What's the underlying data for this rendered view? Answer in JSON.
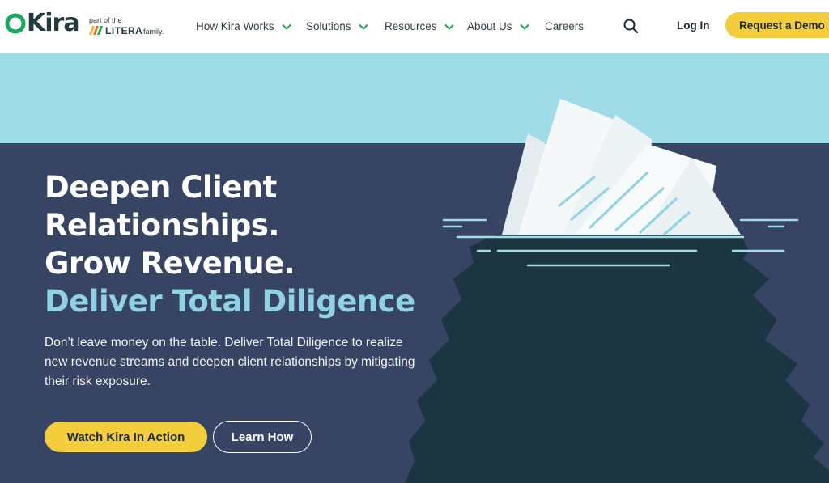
{
  "brand": {
    "logo_text": "Kira",
    "litera_prefix": "part of the",
    "litera_name": "LITERA",
    "litera_suffix": "family."
  },
  "nav": {
    "items": [
      {
        "label": "How Kira Works",
        "has_dropdown": true
      },
      {
        "label": "Solutions",
        "has_dropdown": true
      },
      {
        "label": "Resources",
        "has_dropdown": true
      },
      {
        "label": "About Us",
        "has_dropdown": true
      },
      {
        "label": "Careers",
        "has_dropdown": false
      }
    ],
    "search_icon": "search-icon",
    "login_label": "Log In",
    "demo_label": "Request a Demo"
  },
  "hero": {
    "headline_lines": [
      "Deepen Client",
      "Relationships.",
      "Grow Revenue."
    ],
    "headline_accent": "Deliver Total Diligence",
    "lede": "Don’t leave money on the table. Deliver Total Diligence to realize new revenue streams and deepen client relationships by mitigating their risk exposure.",
    "primary_cta": "Watch Kira In Action",
    "secondary_cta": "Learn How",
    "illustration": "iceberg-of-documents"
  },
  "colors": {
    "brand_green": "#1aa85b",
    "dark_text": "#233a3e",
    "accent_yellow": "#f3cd3b",
    "sky": "#a0dbe8",
    "sea": "#384464",
    "iceberg_dark": "#1b3640",
    "headline_accent": "#8fd2e3"
  }
}
